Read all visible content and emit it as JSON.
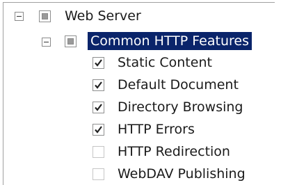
{
  "tree": {
    "root": {
      "label": "Web Server",
      "state": "indeterminate",
      "expanded": true
    },
    "group": {
      "label": "Common HTTP Features",
      "state": "indeterminate",
      "expanded": true,
      "selected": true
    },
    "items": [
      {
        "label": "Static Content",
        "checked": true
      },
      {
        "label": "Default Document",
        "checked": true
      },
      {
        "label": "Directory Browsing",
        "checked": true
      },
      {
        "label": "HTTP Errors",
        "checked": true
      },
      {
        "label": "HTTP Redirection",
        "checked": false
      },
      {
        "label": "WebDAV Publishing",
        "checked": false
      }
    ]
  },
  "icons": {
    "expander": "collapse-minus-icon",
    "check": "checkmark-icon"
  }
}
